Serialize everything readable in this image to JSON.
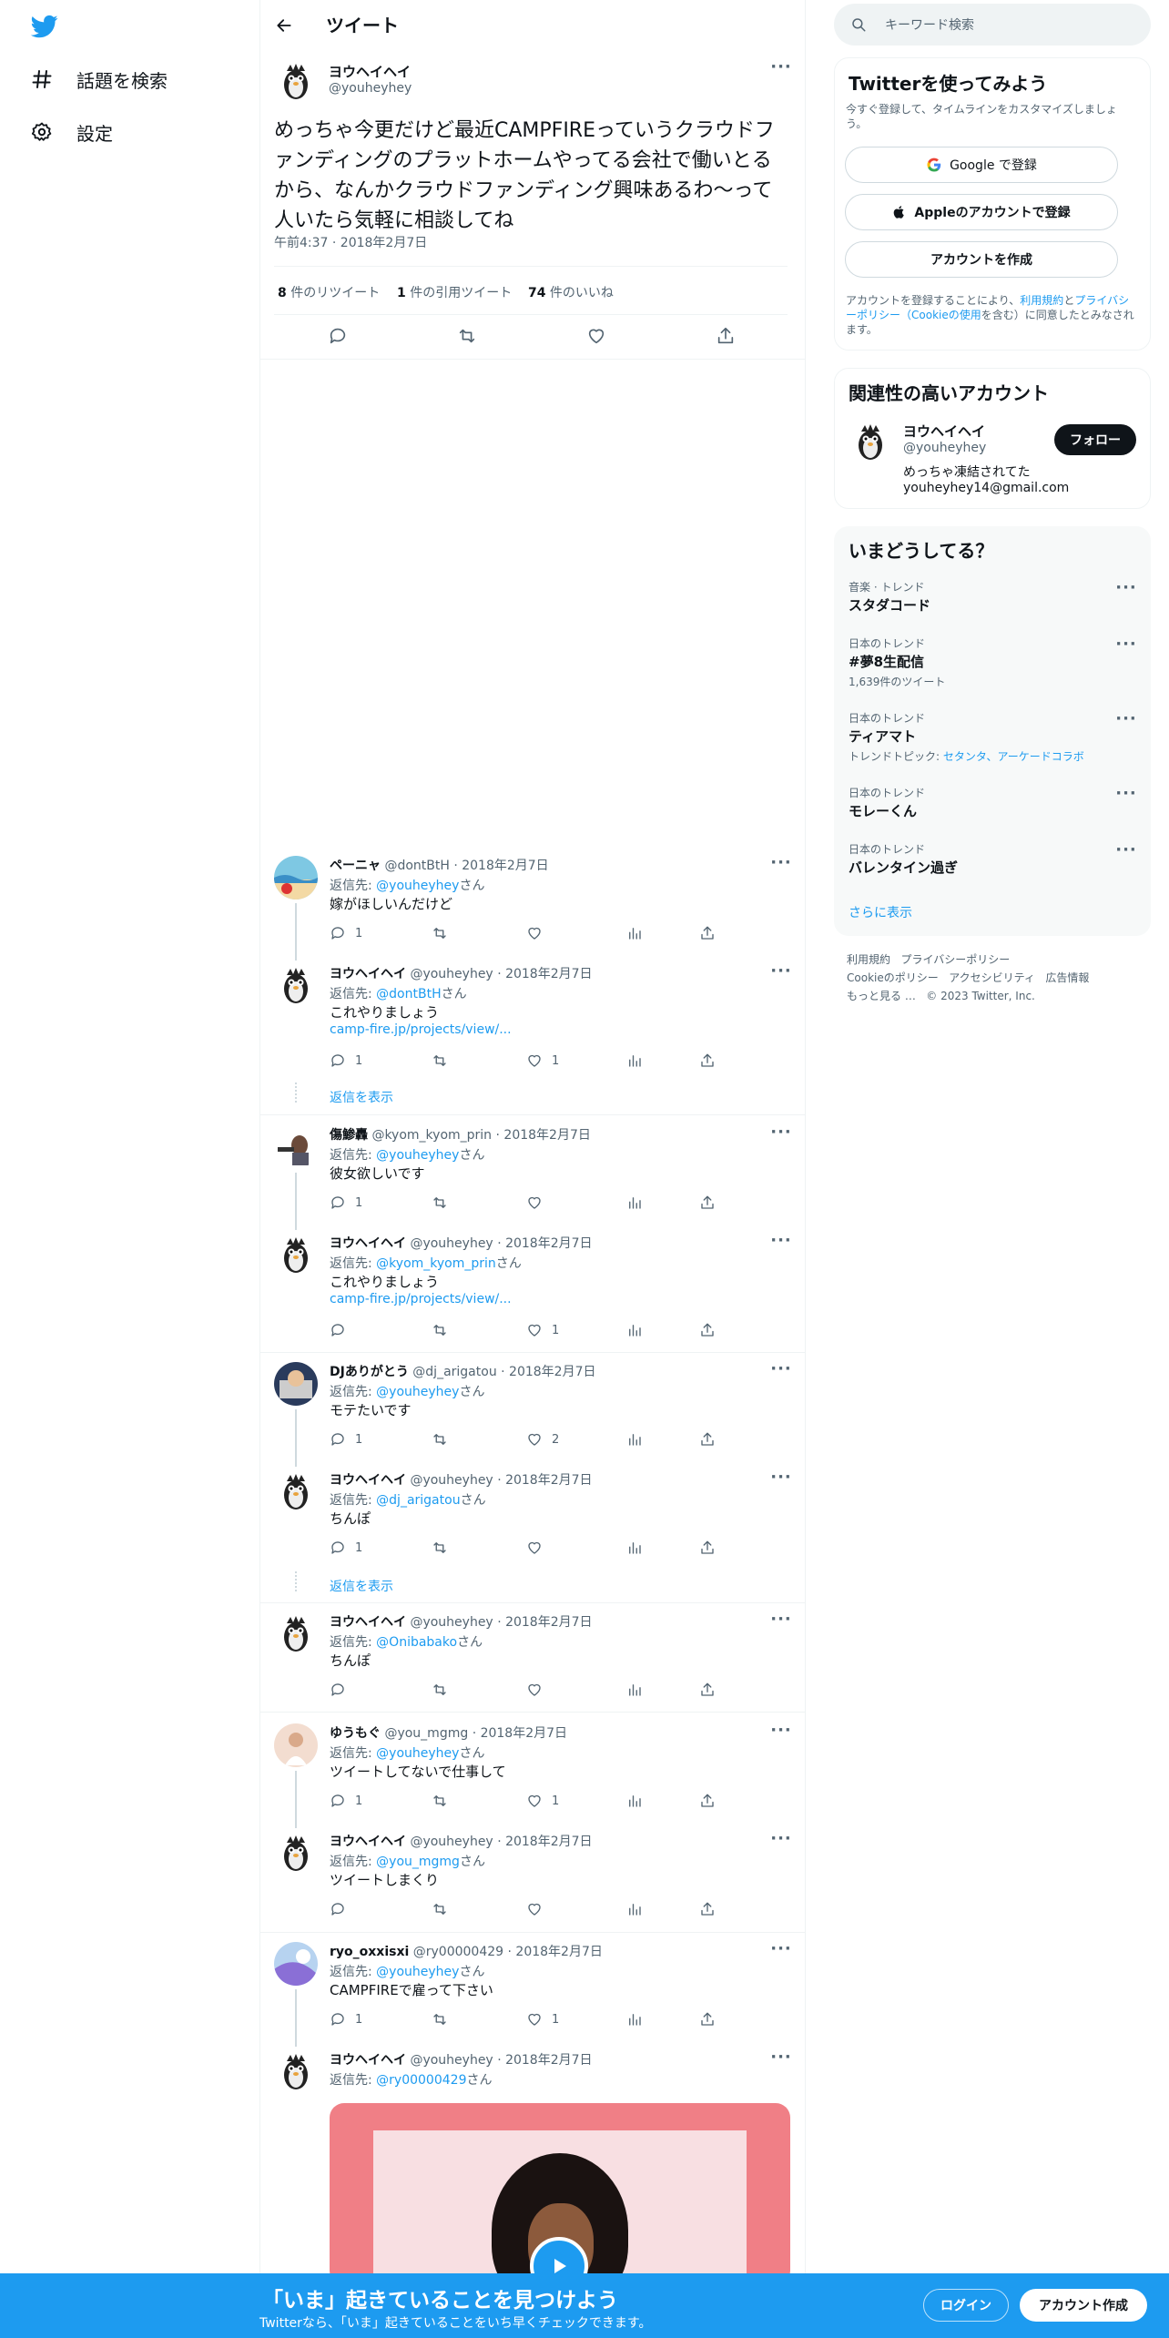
{
  "nav": {
    "explore_label": "話題を検索",
    "settings_label": "設定"
  },
  "header": {
    "title": "ツイート"
  },
  "tweet": {
    "name": "ヨウヘイヘイ",
    "handle": "@youheyhey",
    "text": "めっちゃ今更だけど最近CAMPFIREっていうクラウドファンディングのプラットホームやってる会社で働いとるから、なんかクラウドファンディング興味あるわ〜って人いたら気軽に相談してね",
    "time": "午前4:37 · 2018年2月7日",
    "retweets_count": "8",
    "retweets_label": " 件のリツイート",
    "quotes_count": "1",
    "quotes_label": " 件の引用ツイート",
    "likes_count": "74",
    "likes_label": " 件のいいね"
  },
  "replies": [
    {
      "name": "ペーニャ",
      "handle": "@dontBtH",
      "date": "· 2018年2月7日",
      "reply_prefix": "返信先: ",
      "reply_to": "@youheyhey",
      "reply_suffix": "さん",
      "text": "嫁がほしいんだけど",
      "link": "",
      "replies": "1",
      "retweets": "",
      "likes": ""
    },
    {
      "name": "ヨウヘイヘイ",
      "handle": "@youheyhey",
      "date": "· 2018年2月7日",
      "reply_prefix": "返信先: ",
      "reply_to": "@dontBtH",
      "reply_suffix": "さん",
      "text": "これやりましょう",
      "link": "camp-fire.jp/projects/view/...",
      "replies": "1",
      "retweets": "",
      "likes": "1"
    },
    {
      "name": "傷鯵轟",
      "handle": "@kyom_kyom_prin",
      "date": "· 2018年2月7日",
      "reply_prefix": "返信先: ",
      "reply_to": "@youheyhey",
      "reply_suffix": "さん",
      "text": "彼女欲しいです",
      "link": "",
      "replies": "1",
      "retweets": "",
      "likes": ""
    },
    {
      "name": "ヨウヘイヘイ",
      "handle": "@youheyhey",
      "date": "· 2018年2月7日",
      "reply_prefix": "返信先: ",
      "reply_to": "@kyom_kyom_prin",
      "reply_suffix": "さん",
      "text": "これやりましょう",
      "link": "camp-fire.jp/projects/view/...",
      "replies": "",
      "retweets": "",
      "likes": "1"
    },
    {
      "name": "DJありがとう",
      "handle": "@dj_arigatou",
      "date": "· 2018年2月7日",
      "reply_prefix": "返信先: ",
      "reply_to": "@youheyhey",
      "reply_suffix": "さん",
      "text": "モテたいです",
      "link": "",
      "replies": "1",
      "retweets": "",
      "likes": "2"
    },
    {
      "name": "ヨウヘイヘイ",
      "handle": "@youheyhey",
      "date": "· 2018年2月7日",
      "reply_prefix": "返信先: ",
      "reply_to": "@dj_arigatou",
      "reply_suffix": "さん",
      "text": "ちんぽ",
      "link": "",
      "replies": "1",
      "retweets": "",
      "likes": ""
    },
    {
      "name": "ヨウヘイヘイ",
      "handle": "@youheyhey",
      "date": "· 2018年2月7日",
      "reply_prefix": "返信先: ",
      "reply_to": "@Onibabako",
      "reply_suffix": "さん",
      "text": "ちんぽ",
      "link": "",
      "replies": "",
      "retweets": "",
      "likes": ""
    },
    {
      "name": "ゆうもぐ",
      "handle": "@you_mgmg",
      "date": "· 2018年2月7日",
      "reply_prefix": "返信先: ",
      "reply_to": "@youheyhey",
      "reply_suffix": "さん",
      "text": "ツイートしてないで仕事して",
      "link": "",
      "replies": "1",
      "retweets": "",
      "likes": "1"
    },
    {
      "name": "ヨウヘイヘイ",
      "handle": "@youheyhey",
      "date": "· 2018年2月7日",
      "reply_prefix": "返信先: ",
      "reply_to": "@you_mgmg",
      "reply_suffix": "さん",
      "text": "ツイートしまくり",
      "link": "",
      "replies": "",
      "retweets": "",
      "likes": ""
    },
    {
      "name": "ryo_oxxisxi",
      "handle": "@ry00000429",
      "date": "· 2018年2月7日",
      "reply_prefix": "返信先: ",
      "reply_to": "@youheyhey",
      "reply_suffix": "さん",
      "text": "CAMPFIREで雇って下さい",
      "link": "",
      "replies": "1",
      "retweets": "",
      "likes": "1"
    },
    {
      "name": "ヨウヘイヘイ",
      "handle": "@youheyhey",
      "date": "· 2018年2月7日",
      "reply_prefix": "返信先: ",
      "reply_to": "@ry00000429",
      "reply_suffix": "さん",
      "text": "",
      "link": "",
      "replies": "",
      "retweets": "",
      "likes": ""
    }
  ],
  "show_replies_label": "返信を表示",
  "search": {
    "placeholder": "キーワード検索"
  },
  "signup_card": {
    "title": "Twitterを使ってみよう",
    "subtitle": "今すぐ登録して、タイムラインをカスタマイズしましょう。",
    "google_label": "Google で登録",
    "apple_label": "Appleのアカウントで登録",
    "create_label": "アカウントを作成",
    "terms_1": "アカウントを登録することにより、",
    "terms_link1": "利用規約",
    "terms_2": "と",
    "terms_link2": "プライバシーポリシー（Cookieの使用",
    "terms_3": "を含む）に同意したとみなされます。"
  },
  "relevant": {
    "title": "関連性の高いアカウント",
    "name": "ヨウヘイヘイ",
    "handle": "@youheyhey",
    "bio_1": "めっちゃ凍結されてた",
    "bio_2": "youheyhey14@gmail.com",
    "follow_label": "フォロー"
  },
  "trends": {
    "title": "いまどうしてる？",
    "items": [
      {
        "cat": "音楽 · トレンド",
        "name": "スタダコード",
        "sub": "",
        "sub_links": ""
      },
      {
        "cat": "日本のトレンド",
        "name": "#夢8生配信",
        "sub": "1,639件のツイート",
        "sub_links": ""
      },
      {
        "cat": "日本のトレンド",
        "name": "ティアマト",
        "sub": "トレンドトピック: ",
        "sub_links": "セタンタ、アーケードコラボ"
      },
      {
        "cat": "日本のトレンド",
        "name": "モレーくん",
        "sub": "",
        "sub_links": ""
      },
      {
        "cat": "日本のトレンド",
        "name": "バレンタイン過ぎ",
        "sub": "",
        "sub_links": ""
      }
    ],
    "show_more": "さらに表示"
  },
  "footer": {
    "line1a": "利用規約",
    "line1b": "プライバシーポリシー",
    "line2a": "Cookieのポリシー",
    "line2b": "アクセシビリティ",
    "line2c": "広告情報",
    "line3a": "もっと見る …",
    "line3b": "© 2023 Twitter, Inc."
  },
  "banner": {
    "title": "「いま」起きていることを見つけよう",
    "subtitle": "Twitterなら、「いま」起きていることをいち早くチェックできます。",
    "login_label": "ログイン",
    "signup_label": "アカウント作成"
  },
  "colors": {
    "accent": "#1d9bf0",
    "text": "#0f1419",
    "secondary": "#536471",
    "border": "#eff3f4"
  }
}
